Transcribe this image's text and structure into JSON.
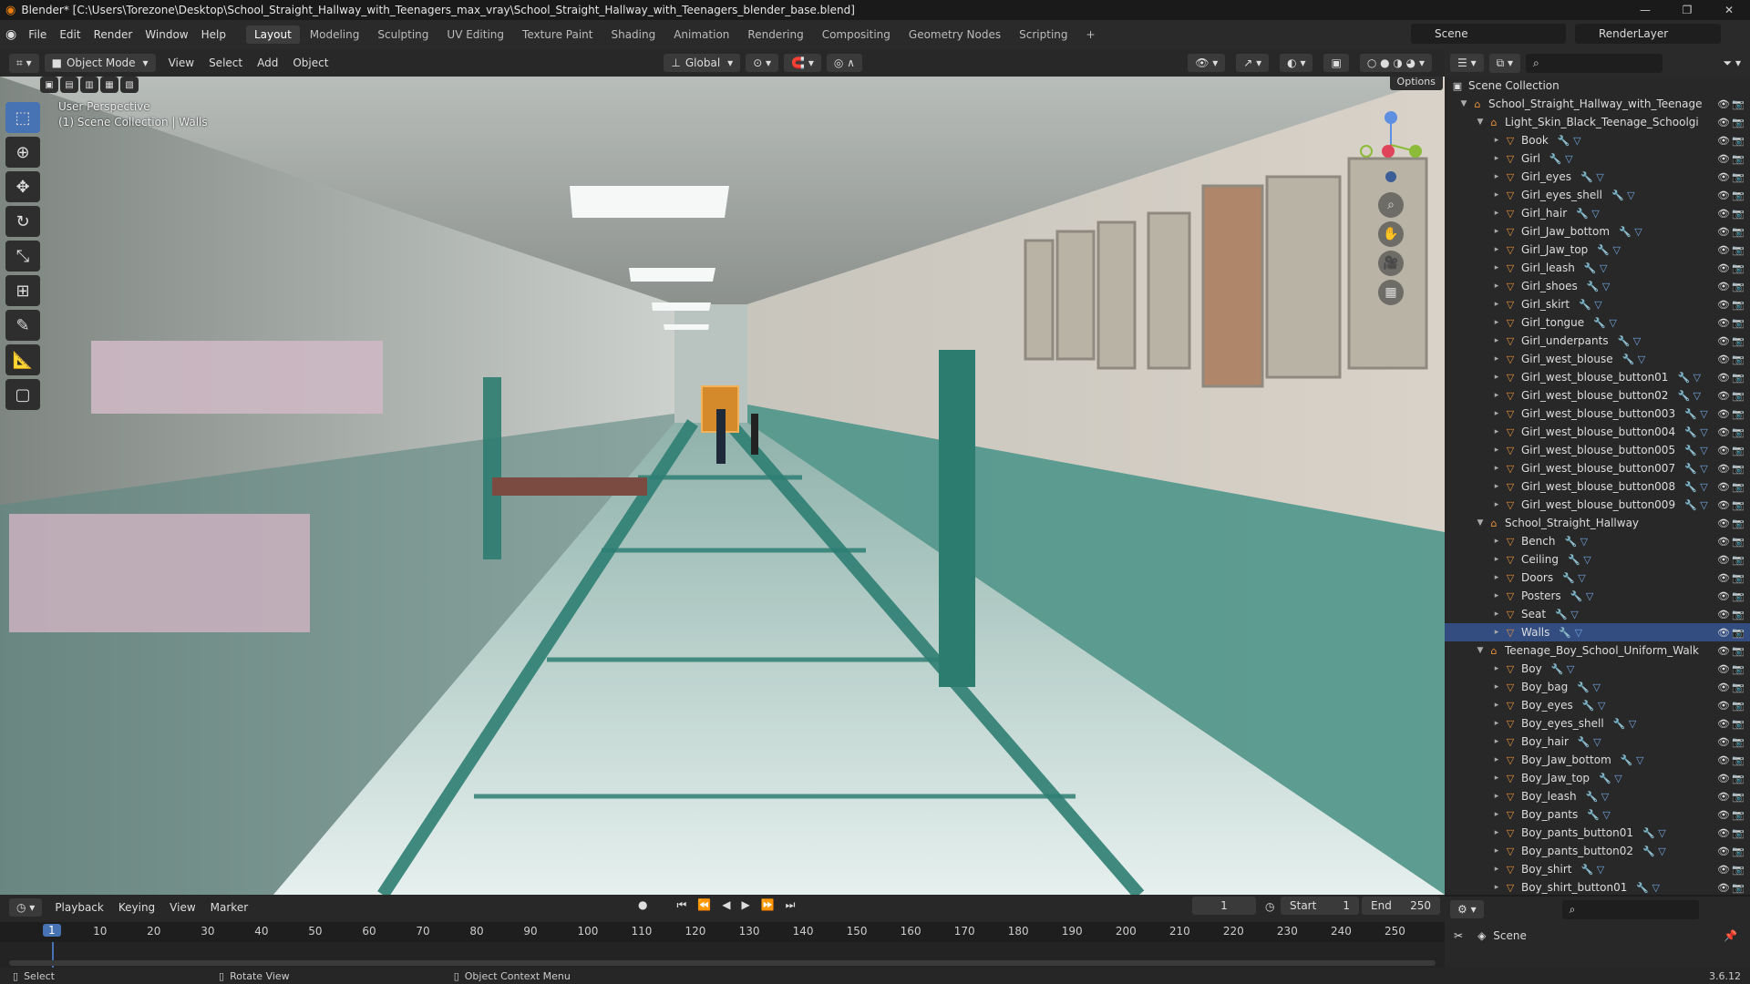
{
  "title_bar": {
    "title": "Blender* [C:\\Users\\Torezone\\Desktop\\School_Straight_Hallway_with_Teenagers_max_vray\\School_Straight_Hallway_with_Teenagers_blender_base.blend]",
    "minimize": "—",
    "maximize": "❐",
    "close": "✕"
  },
  "menu": {
    "items": [
      "File",
      "Edit",
      "Render",
      "Window",
      "Help"
    ],
    "workspaces": [
      "Layout",
      "Modeling",
      "Sculpting",
      "UV Editing",
      "Texture Paint",
      "Shading",
      "Animation",
      "Rendering",
      "Compositing",
      "Geometry Nodes",
      "Scripting",
      "+"
    ],
    "active_workspace": "Layout",
    "scene": "Scene",
    "view_layer": "RenderLayer"
  },
  "viewport_header": {
    "mode": "Object Mode",
    "menus": [
      "View",
      "Select",
      "Add",
      "Object"
    ],
    "transform_orientation": "Global",
    "options": "Options"
  },
  "viewport": {
    "perspective": "User Perspective",
    "collection_info": "(1) Scene Collection | Walls"
  },
  "outliner": {
    "root": "Scene Collection",
    "rows": [
      {
        "label": "School_Straight_Hallway_with_Teenage",
        "type": "collection",
        "depth": 1,
        "expanded": true
      },
      {
        "label": "Light_Skin_Black_Teenage_Schoolgi",
        "type": "collection",
        "depth": 2,
        "expanded": true
      },
      {
        "label": "Book",
        "type": "mesh",
        "depth": 3
      },
      {
        "label": "Girl",
        "type": "mesh",
        "depth": 3
      },
      {
        "label": "Girl_eyes",
        "type": "mesh",
        "depth": 3
      },
      {
        "label": "Girl_eyes_shell",
        "type": "mesh",
        "depth": 3
      },
      {
        "label": "Girl_hair",
        "type": "mesh",
        "depth": 3
      },
      {
        "label": "Girl_Jaw_bottom",
        "type": "mesh",
        "depth": 3
      },
      {
        "label": "Girl_Jaw_top",
        "type": "mesh",
        "depth": 3
      },
      {
        "label": "Girl_leash",
        "type": "mesh",
        "depth": 3
      },
      {
        "label": "Girl_shoes",
        "type": "mesh",
        "depth": 3
      },
      {
        "label": "Girl_skirt",
        "type": "mesh",
        "depth": 3
      },
      {
        "label": "Girl_tongue",
        "type": "mesh",
        "depth": 3
      },
      {
        "label": "Girl_underpants",
        "type": "mesh",
        "depth": 3
      },
      {
        "label": "Girl_west_blouse",
        "type": "mesh",
        "depth": 3
      },
      {
        "label": "Girl_west_blouse_button01",
        "type": "mesh",
        "depth": 3
      },
      {
        "label": "Girl_west_blouse_button02",
        "type": "mesh",
        "depth": 3
      },
      {
        "label": "Girl_west_blouse_button003",
        "type": "mesh",
        "depth": 3
      },
      {
        "label": "Girl_west_blouse_button004",
        "type": "mesh",
        "depth": 3
      },
      {
        "label": "Girl_west_blouse_button005",
        "type": "mesh",
        "depth": 3
      },
      {
        "label": "Girl_west_blouse_button007",
        "type": "mesh",
        "depth": 3
      },
      {
        "label": "Girl_west_blouse_button008",
        "type": "mesh",
        "depth": 3
      },
      {
        "label": "Girl_west_blouse_button009",
        "type": "mesh",
        "depth": 3
      },
      {
        "label": "School_Straight_Hallway",
        "type": "collection",
        "depth": 2,
        "expanded": true
      },
      {
        "label": "Bench",
        "type": "mesh",
        "depth": 3
      },
      {
        "label": "Ceiling",
        "type": "mesh",
        "depth": 3
      },
      {
        "label": "Doors",
        "type": "mesh",
        "depth": 3
      },
      {
        "label": "Posters",
        "type": "mesh",
        "depth": 3
      },
      {
        "label": "Seat",
        "type": "mesh",
        "depth": 3
      },
      {
        "label": "Walls",
        "type": "mesh",
        "depth": 3,
        "selected": true
      },
      {
        "label": "Teenage_Boy_School_Uniform_Walk",
        "type": "collection",
        "depth": 2,
        "expanded": true
      },
      {
        "label": "Boy",
        "type": "mesh",
        "depth": 3
      },
      {
        "label": "Boy_bag",
        "type": "mesh",
        "depth": 3
      },
      {
        "label": "Boy_eyes",
        "type": "mesh",
        "depth": 3
      },
      {
        "label": "Boy_eyes_shell",
        "type": "mesh",
        "depth": 3
      },
      {
        "label": "Boy_hair",
        "type": "mesh",
        "depth": 3
      },
      {
        "label": "Boy_Jaw_bottom",
        "type": "mesh",
        "depth": 3
      },
      {
        "label": "Boy_Jaw_top",
        "type": "mesh",
        "depth": 3
      },
      {
        "label": "Boy_leash",
        "type": "mesh",
        "depth": 3
      },
      {
        "label": "Boy_pants",
        "type": "mesh",
        "depth": 3
      },
      {
        "label": "Boy_pants_button01",
        "type": "mesh",
        "depth": 3
      },
      {
        "label": "Boy_pants_button02",
        "type": "mesh",
        "depth": 3
      },
      {
        "label": "Boy_shirt",
        "type": "mesh",
        "depth": 3
      },
      {
        "label": "Boy_shirt_button01",
        "type": "mesh",
        "depth": 3
      }
    ]
  },
  "timeline": {
    "menus": [
      "Playback",
      "Keying",
      "View",
      "Marker"
    ],
    "current_frame": "1",
    "start_label": "Start",
    "start": "1",
    "end_label": "End",
    "end": "250",
    "ticks": [
      "10",
      "20",
      "30",
      "40",
      "50",
      "60",
      "70",
      "80",
      "90",
      "100",
      "110",
      "120",
      "130",
      "140",
      "150",
      "160",
      "170",
      "180",
      "190",
      "200",
      "210",
      "220",
      "230",
      "240",
      "250"
    ]
  },
  "properties": {
    "scene": "Scene"
  },
  "status_bar": {
    "select": "Select",
    "rotate": "Rotate View",
    "context": "Object Context Menu",
    "version": "3.6.12"
  }
}
